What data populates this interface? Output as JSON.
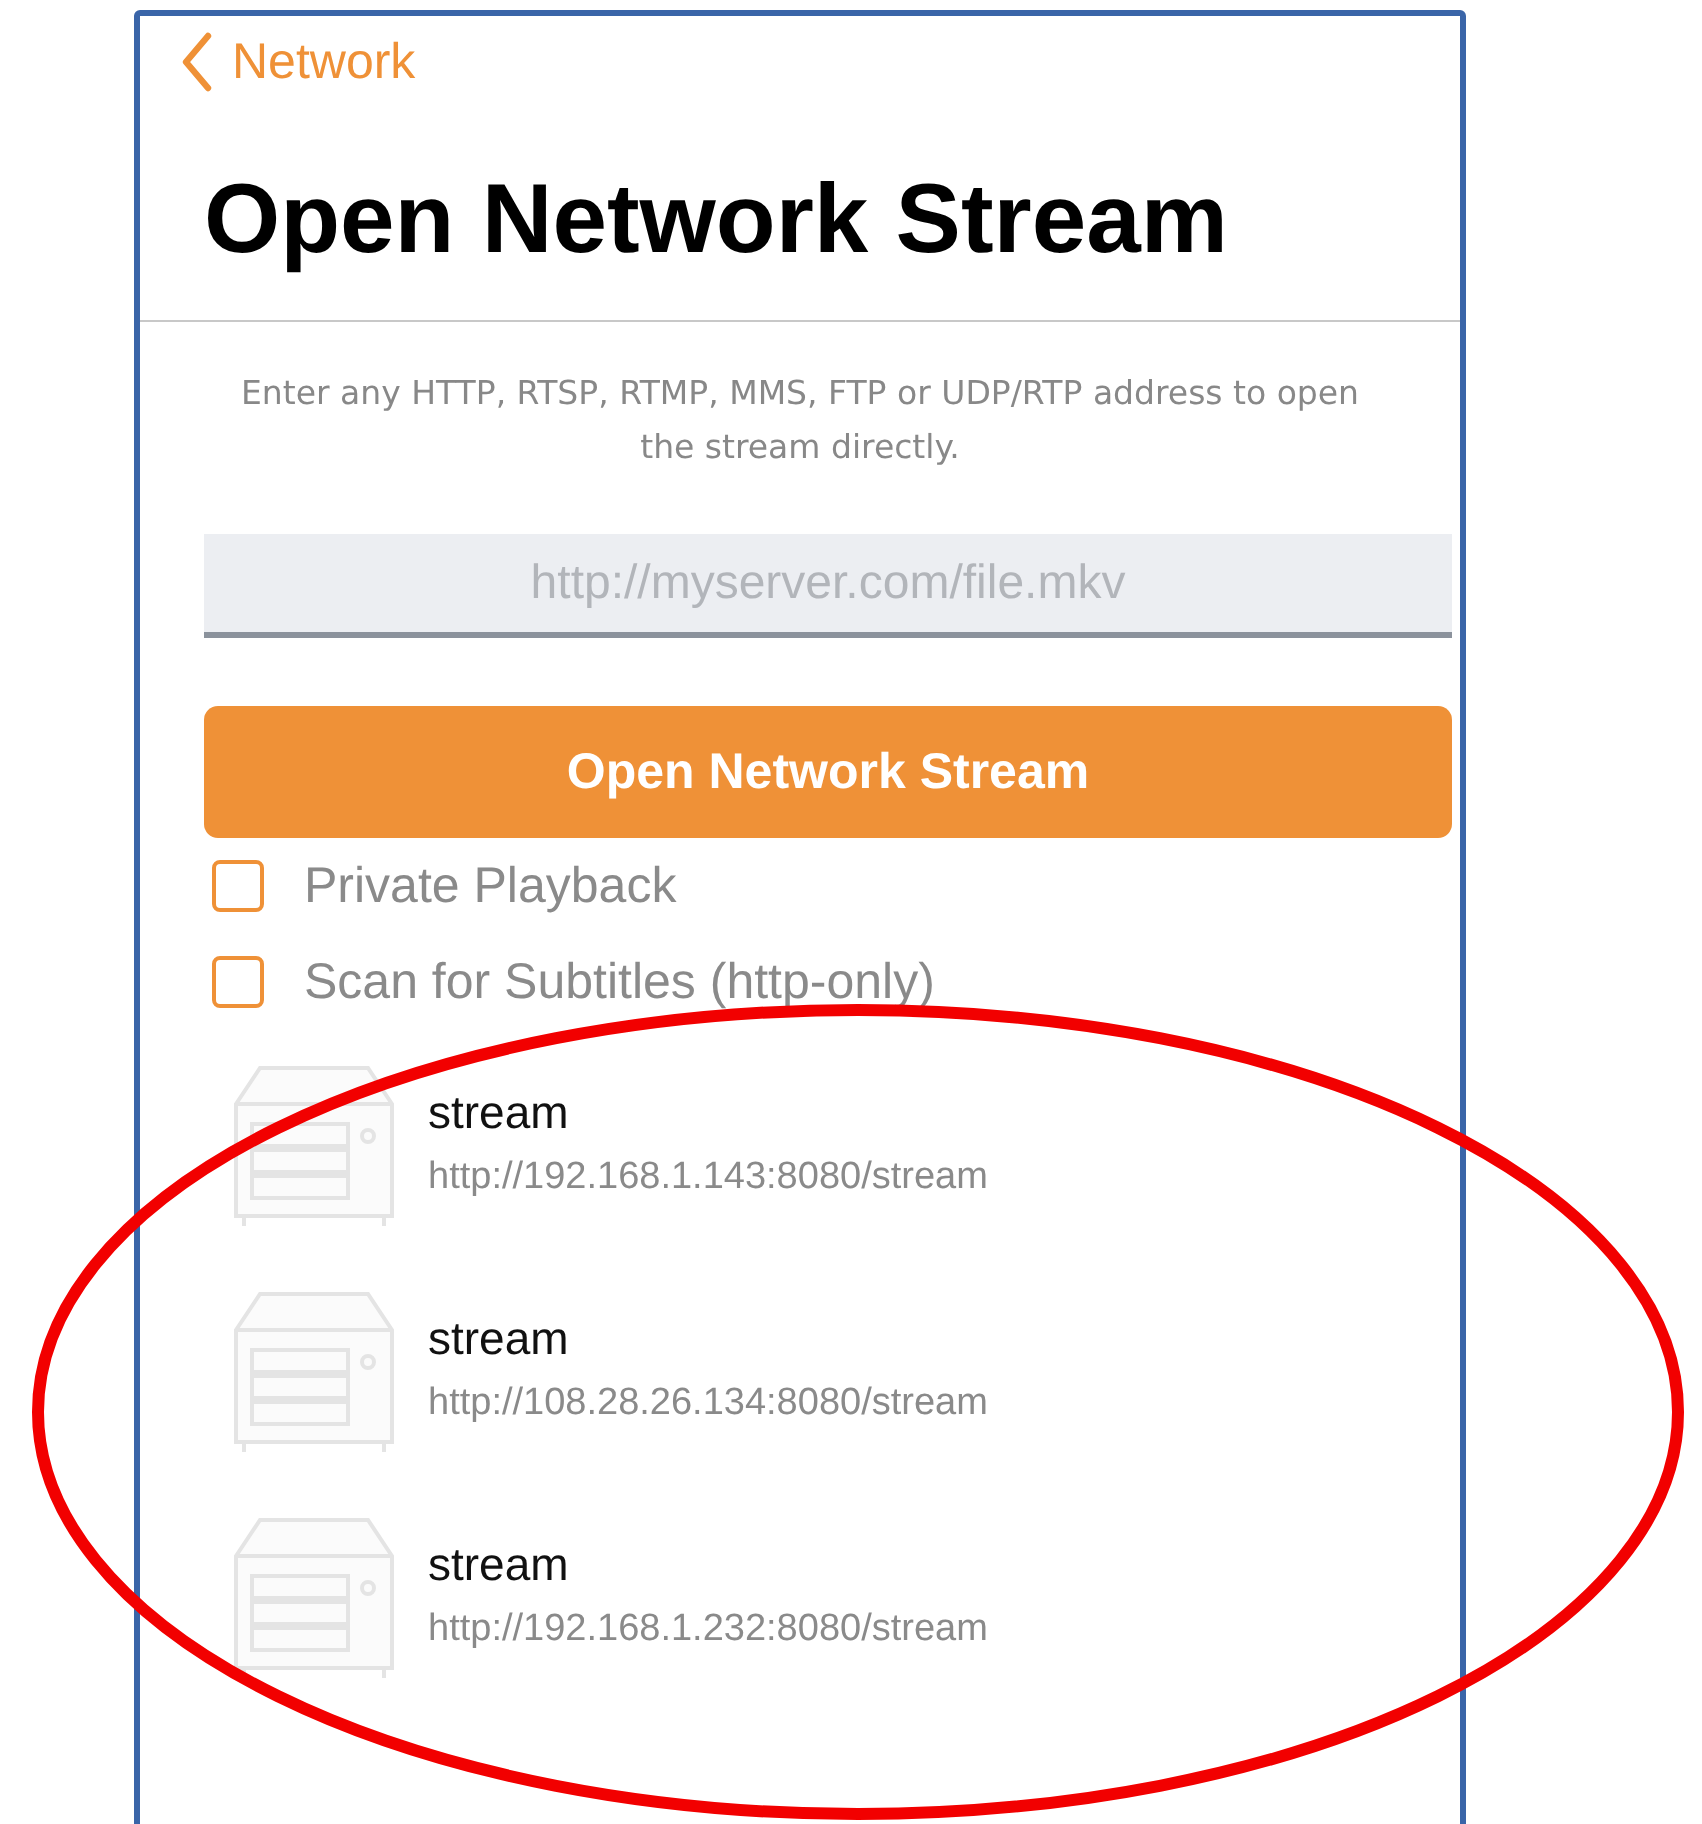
{
  "nav": {
    "back_label": "Network"
  },
  "title": "Open Network Stream",
  "description": "Enter any HTTP, RTSP, RTMP, MMS, FTP or UDP/RTP address to open the stream directly.",
  "url_field": {
    "placeholder": "http://myserver.com/file.mkv"
  },
  "open_button": "Open Network Stream",
  "options": [
    {
      "label": "Private Playback",
      "checked": false
    },
    {
      "label": "Scan for Subtitles (http-only)",
      "checked": false
    }
  ],
  "streams": [
    {
      "name": "stream",
      "url": "http://192.168.1.143:8080/stream"
    },
    {
      "name": "stream",
      "url": "http://108.28.26.134:8080/stream"
    },
    {
      "name": "stream",
      "url": "http://192.168.1.232:8080/stream"
    }
  ]
}
